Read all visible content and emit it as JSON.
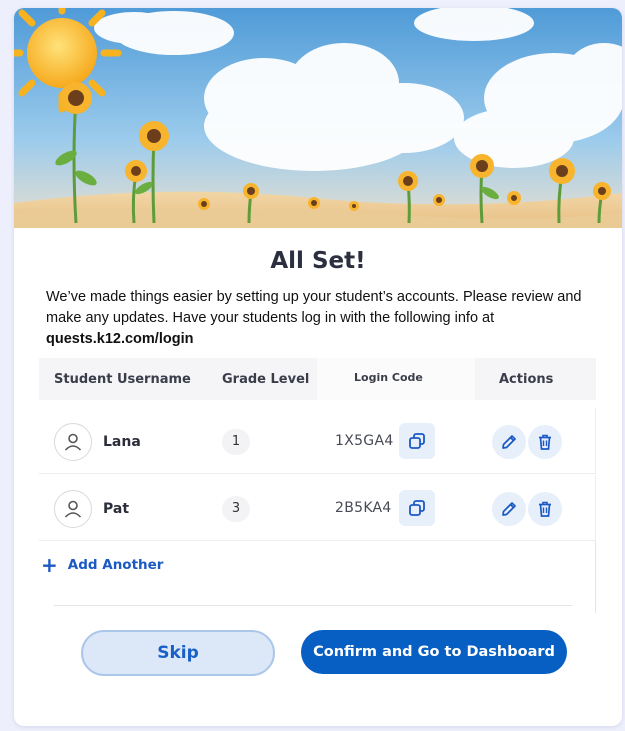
{
  "hero": {
    "icon": "sunflower-field-illustration"
  },
  "title": "All Set!",
  "intro": {
    "text": "We’ve made things easier by setting up your student’s accounts. Please review and make any updates. Have your students log in with the following info at",
    "url": "quests.k12.com/login"
  },
  "table": {
    "headers": {
      "username": "Student Username",
      "grade": "Grade Level",
      "code": "Login Code",
      "actions": "Actions"
    },
    "rows": [
      {
        "username": "Lana",
        "grade": "1",
        "code": "1X5GA4"
      },
      {
        "username": "Pat",
        "grade": "3",
        "code": "2B5KA4"
      }
    ]
  },
  "add_another_label": "Add Another",
  "buttons": {
    "skip": "Skip",
    "confirm": "Confirm and Go to Dashboard"
  },
  "colors": {
    "accent": "#075fc4",
    "background": "#edeffc",
    "icon_blue": "#1b59c4"
  }
}
